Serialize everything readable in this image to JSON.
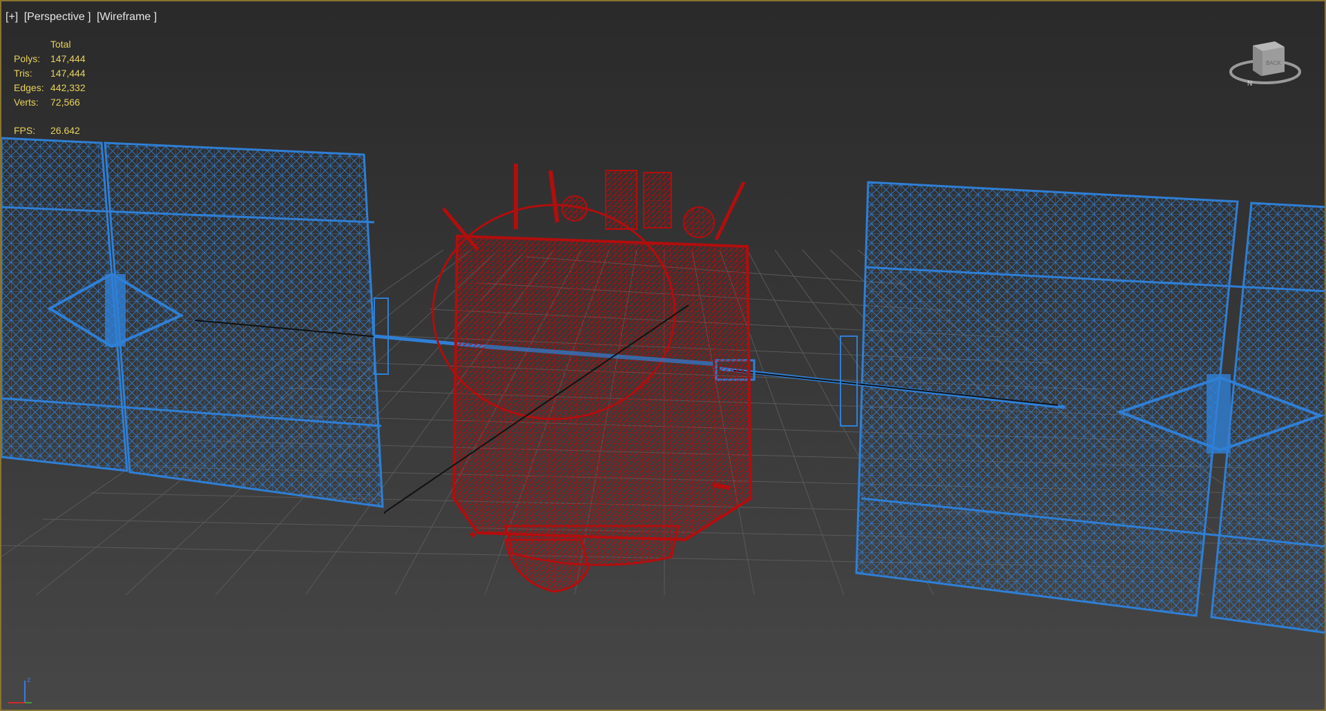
{
  "viewport_label": {
    "plus": "[+]",
    "view": "[Perspective ]",
    "shading": "[Wireframe ]"
  },
  "stats": {
    "header": "Total",
    "polys_label": "Polys:",
    "polys": "147,444",
    "tris_label": "Tris:",
    "tris": "147,444",
    "edges_label": "Edges:",
    "edges": "442,332",
    "verts_label": "Verts:",
    "verts": "72,566",
    "fps_label": "FPS:",
    "fps": "26.642"
  },
  "viewcube": {
    "face": "BACK"
  },
  "axis": {
    "z": "z"
  },
  "colors": {
    "solar_panels": "#2f7fd6",
    "satellite_body": "#b30d0d",
    "stats_text": "#e8d25e",
    "viewport_border": "#8a7530"
  }
}
